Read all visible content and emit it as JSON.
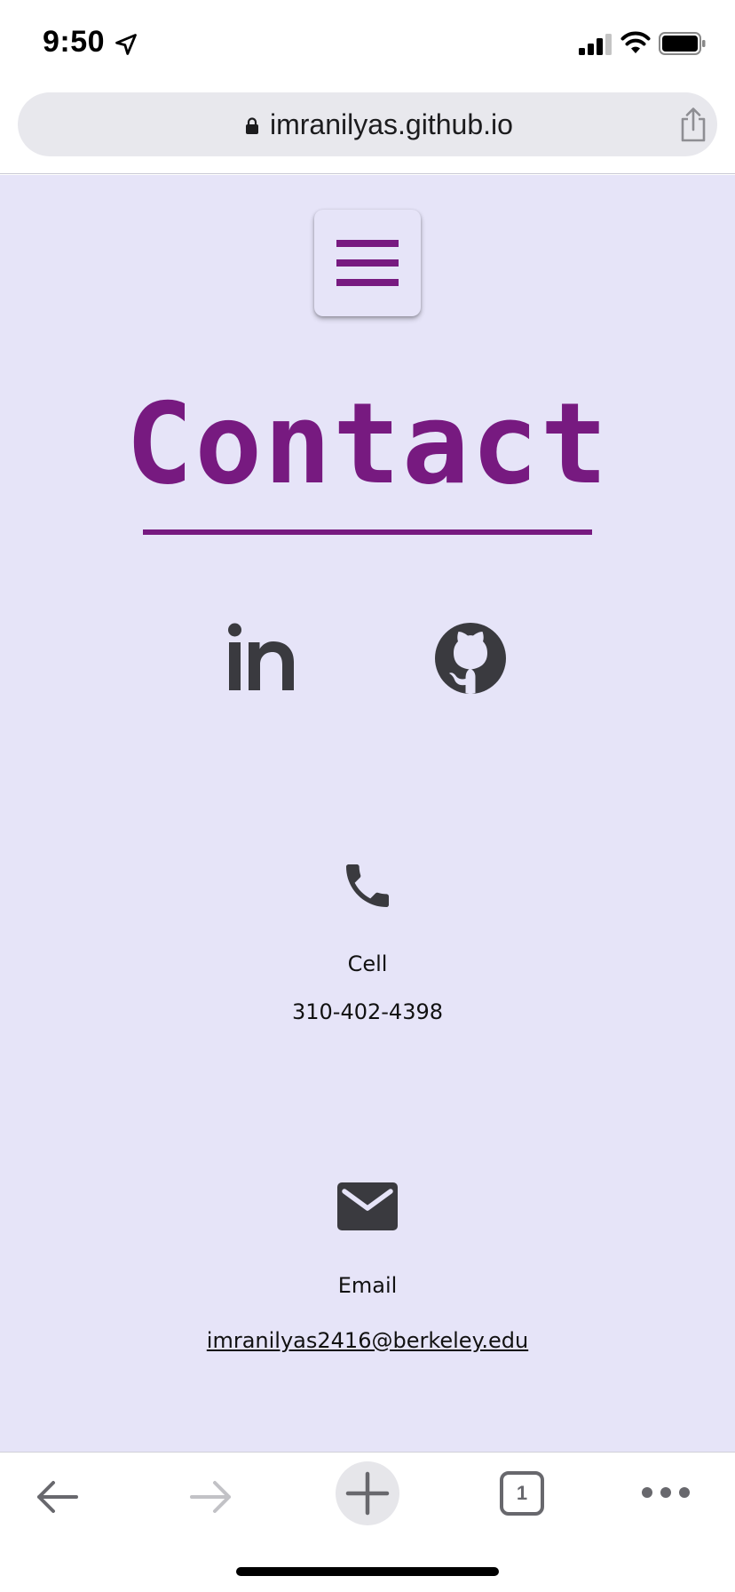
{
  "status_bar": {
    "time": "9:50",
    "icons": [
      "location-arrow-icon",
      "cellular-signal-icon",
      "wifi-icon",
      "battery-icon"
    ]
  },
  "browser": {
    "url": "imranilyas.github.io",
    "icons": [
      "lock-icon",
      "share-icon"
    ]
  },
  "page": {
    "background_color": "#e6e4f8",
    "accent_color": "#771a80",
    "menu_icon": "hamburger-menu-icon",
    "title": "Contact",
    "social_links": [
      {
        "icon": "linkedin-icon"
      },
      {
        "icon": "github-icon"
      }
    ],
    "phone": {
      "icon": "phone-icon",
      "label": "Cell",
      "number": "310-402-4398"
    },
    "email": {
      "icon": "envelope-icon",
      "label": "Email",
      "address": "imranilyas2416@berkeley.edu"
    }
  },
  "toolbar": {
    "buttons": [
      "back-arrow-icon",
      "forward-arrow-icon",
      "plus-icon",
      "tabs-icon",
      "more-icon"
    ],
    "tab_count": "1"
  }
}
